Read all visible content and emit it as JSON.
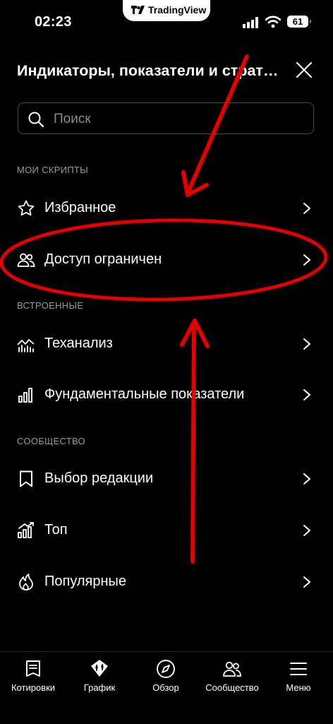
{
  "status_bar": {
    "time": "02:23",
    "battery": "61",
    "island_brand": "TradingView"
  },
  "header": {
    "title": "Индикаторы, показатели и стратегии",
    "close_icon": "close-icon"
  },
  "search": {
    "placeholder": "Поиск",
    "value": ""
  },
  "sections": {
    "my_scripts": "МОИ СКРИПТЫ",
    "builtin": "ВСТРОЕННЫЕ",
    "community": "СООБЩЕСТВО"
  },
  "items": {
    "favorites": "Избранное",
    "restricted": "Доступ ограничен",
    "technicals": "Теханализ",
    "fundamentals": "Фундаментальные показатели",
    "editors_picks": "Выбор редакции",
    "top": "Топ",
    "popular": "Популярные"
  },
  "tabbar": {
    "quotes": "Котировки",
    "chart": "График",
    "overview": "Обзор",
    "community": "Сообщество",
    "menu": "Меню"
  },
  "colors": {
    "annotation": "#e30000",
    "background": "#000000",
    "muted": "#9a9a9a"
  }
}
